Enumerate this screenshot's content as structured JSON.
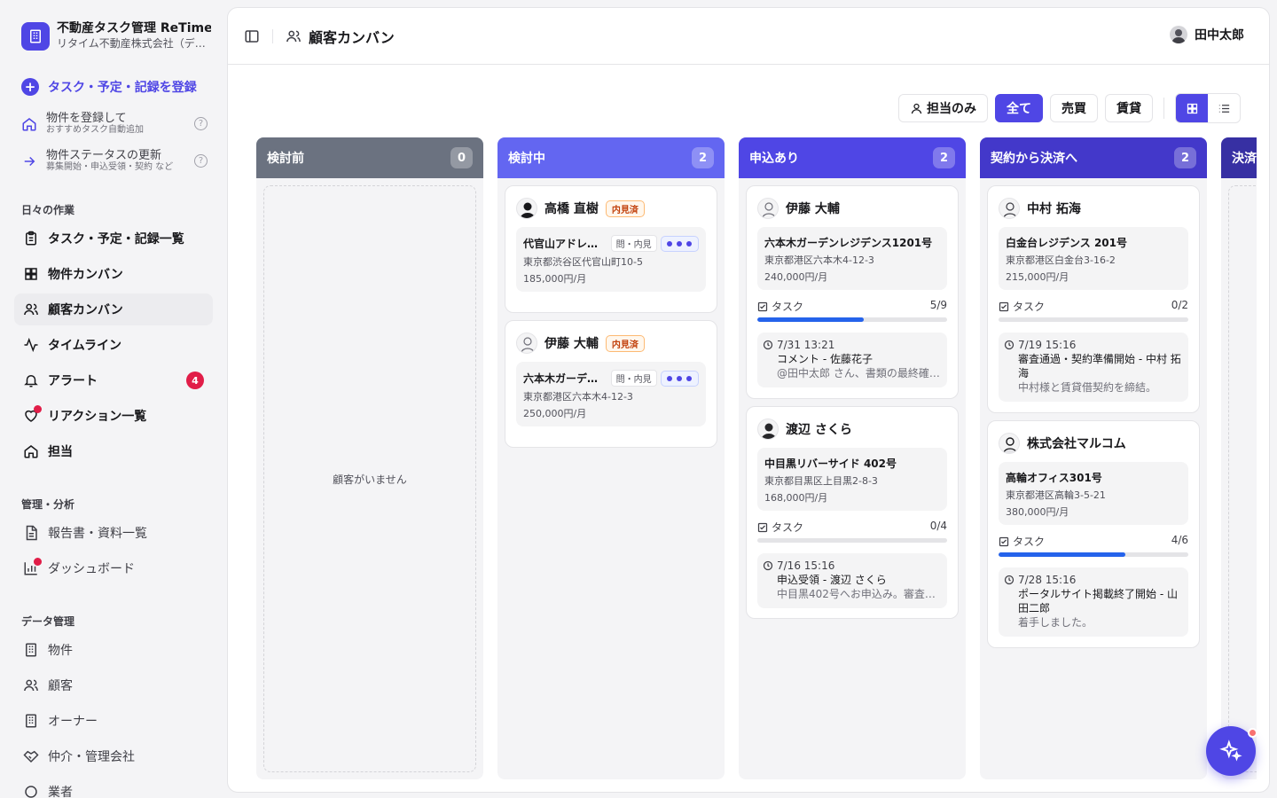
{
  "brand": {
    "title": "不動産タスク管理 ReTime",
    "subtitle": "リタイム不動産株式会社（デ…"
  },
  "quick": {
    "add_label": "タスク・予定・記録を登録",
    "register_property": {
      "main": "物件を登録して",
      "sub": "おすすめタスク自動追加"
    },
    "update_status": {
      "main": "物件ステータスの更新",
      "sub": "募集開始・申込受領・契約 など"
    }
  },
  "sections": {
    "daily": "日々の作業",
    "analysis": "管理・分析",
    "data": "データ管理"
  },
  "nav": {
    "tasks": "タスク・予定・記録一覧",
    "property_kanban": "物件カンバン",
    "customer_kanban": "顧客カンバン",
    "timeline": "タイムライン",
    "alerts": "アラート",
    "alerts_count": "4",
    "reactions": "リアクション一覧",
    "assigned": "担当",
    "reports": "報告書・資料一覧",
    "dashboard": "ダッシュボード",
    "properties": "物件",
    "customers": "顧客",
    "owners": "オーナー",
    "brokers": "仲介・管理会社",
    "cut": "業者"
  },
  "header": {
    "title": "顧客カンバン",
    "user": "田中太郎"
  },
  "filters": {
    "mine": "担当のみ",
    "all": "全て",
    "sale": "売買",
    "rent": "賃貸"
  },
  "columns": [
    {
      "title": "検討前",
      "count": "0",
      "color": "#6b7280",
      "empty": "顧客がいません"
    },
    {
      "title": "検討中",
      "count": "2",
      "color": "#6366f1"
    },
    {
      "title": "申込あり",
      "count": "2",
      "color": "#4f46e5"
    },
    {
      "title": "契約から決済へ",
      "count": "2",
      "color": "#4338ca"
    },
    {
      "title": "決済",
      "color": "#3730a3"
    }
  ],
  "cards": {
    "c1": {
      "name": "高橋 直樹",
      "badge": "内見済",
      "prop": "代官山アドレス…",
      "tag": "問・内見",
      "addr": "東京都渋谷区代官山町10-5",
      "price": "185,000円/月"
    },
    "c2": {
      "name": "伊藤 大輔",
      "badge": "内見済",
      "prop": "六本木ガーデン…",
      "tag": "問・内見",
      "addr": "東京都港区六本木4-12-3",
      "price": "250,000円/月"
    },
    "c3": {
      "name": "伊藤 大輔",
      "prop": "六本木ガーデンレジデンス1201号",
      "addr": "東京都港区六本木4-12-3",
      "price": "240,000円/月",
      "task_label": "タスク",
      "task_count": "5/9",
      "progress": 0.56,
      "act_time": "7/31 13:21",
      "act_title": "コメント - 佐藤花子",
      "act_body": "@田中太郎 さん、書類の最終確…"
    },
    "c4": {
      "name": "渡辺 さくら",
      "prop": "中目黒リバーサイド 402号",
      "addr": "東京都目黒区上目黒2-8-3",
      "price": "168,000円/月",
      "task_label": "タスク",
      "task_count": "0/4",
      "progress": 0,
      "act_time": "7/16 15:16",
      "act_title": "申込受領 - 渡辺 さくら",
      "act_body": "中目黒402号へお申込み。審査…"
    },
    "c5": {
      "name": "中村 拓海",
      "prop": "白金台レジデンス 201号",
      "addr": "東京都港区白金台3-16-2",
      "price": "215,000円/月",
      "task_label": "タスク",
      "task_count": "0/2",
      "progress": 0,
      "act_time": "7/19 15:16",
      "act_title": "審査通過・契約準備開始 - 中村 拓海",
      "act_body": "中村様と賃貸借契約を締結。"
    },
    "c6": {
      "name": "株式会社マルコム",
      "prop": "高輪オフィス301号",
      "addr": "東京都港区高輪3-5-21",
      "price": "380,000円/月",
      "task_label": "タスク",
      "task_count": "4/6",
      "progress": 0.67,
      "act_time": "7/28 15:16",
      "act_title": "ポータルサイト掲載終了開始 - 山田二郎",
      "act_body": "着手しました。"
    }
  }
}
